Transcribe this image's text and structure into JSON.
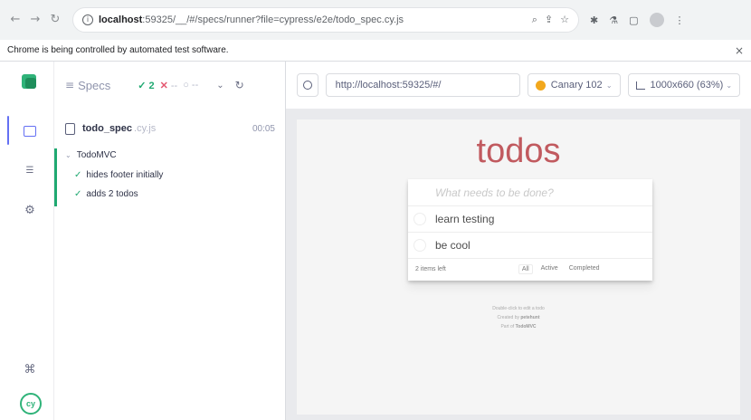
{
  "browser": {
    "back_icon": "back-arrow-icon",
    "forward_icon": "forward-arrow-icon",
    "reload_icon": "reload-icon",
    "url_host": "localhost",
    "url_rest": ":59325/__/#/specs/runner?file=cypress/e2e/todo_spec.cy.js",
    "icons": [
      "zoom-icon",
      "share-icon",
      "bookmark-star-icon",
      "extensions-icon",
      "lab-icon",
      "sidebar-icon",
      "profile-icon",
      "menu-icon"
    ]
  },
  "infobar": {
    "message": "Chrome is being controlled by automated test software.",
    "close": "×"
  },
  "reporter": {
    "specs_label": "Specs",
    "passed": "2",
    "failed": "--",
    "pending": "--",
    "spec_file": {
      "name": "todo_spec",
      "ext": ".cy.js",
      "duration": "00:05"
    },
    "suite": {
      "title": "TodoMVC",
      "tests": [
        {
          "title": "hides footer initially",
          "state": "passed"
        },
        {
          "title": "adds 2 todos",
          "state": "passed"
        }
      ]
    }
  },
  "aut": {
    "url": "http://localhost:59325/#/",
    "browser": "Canary 102",
    "viewport": "1000x660 (63%)"
  },
  "todo_app": {
    "title": "todos",
    "placeholder": "What needs to be done?",
    "items": [
      "learn testing",
      "be cool"
    ],
    "items_left": "2 items left",
    "filters": [
      "All",
      "Active",
      "Completed"
    ],
    "info": [
      "Double-click to edit a todo",
      "Created by ",
      "Part of "
    ],
    "info_author": "petehunt",
    "info_project": "TodoMVC"
  },
  "colors": {
    "pass": "#1fa971",
    "fail": "#e45770",
    "todos_title": "#b83f45",
    "canary": "#f2a81d"
  }
}
